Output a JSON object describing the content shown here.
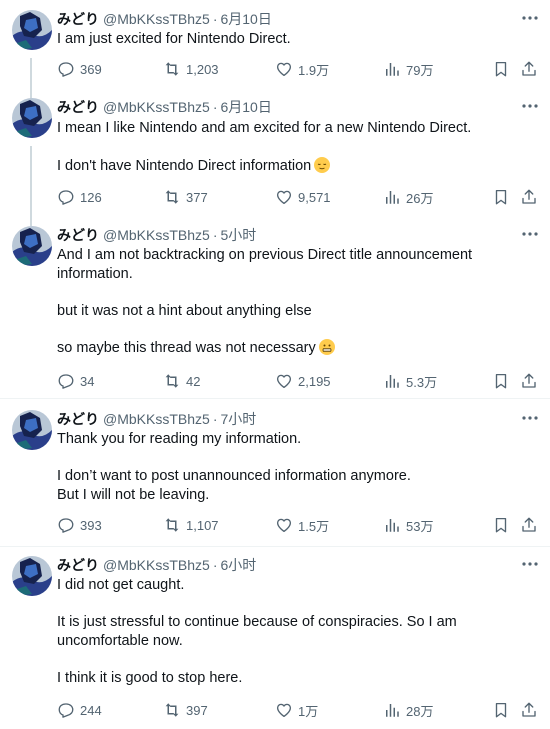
{
  "author": {
    "display_name": "みどり",
    "handle": "@MbKKssTBhz5"
  },
  "separator": "·",
  "tweets": [
    {
      "time": "6月10日",
      "paragraphs": [
        "I am just excited for Nintendo Direct."
      ],
      "emoji": null,
      "stats": {
        "replies": "369",
        "retweets": "1,203",
        "likes": "1.9万",
        "views": "79万"
      }
    },
    {
      "time": "6月10日",
      "paragraphs": [
        "I mean I like Nintendo and am excited for a new Nintendo Direct.",
        "I don't have Nintendo Direct information"
      ],
      "emoji": "relieved-face",
      "stats": {
        "replies": "126",
        "retweets": "377",
        "likes": "9,571",
        "views": "26万"
      }
    },
    {
      "time": "5小时",
      "paragraphs": [
        "And I am not backtracking on previous Direct title announcement information.",
        "but it was not a hint about anything else",
        "so maybe this thread was not necessary"
      ],
      "emoji": "grimacing-face",
      "stats": {
        "replies": "34",
        "retweets": "42",
        "likes": "2,195",
        "views": "5.3万"
      }
    },
    {
      "time": "7小时",
      "paragraphs": [
        "Thank you for reading my information.",
        "I don’t want to post unannounced information anymore.\nBut I will not be leaving."
      ],
      "emoji": null,
      "stats": {
        "replies": "393",
        "retweets": "1,107",
        "likes": "1.5万",
        "views": "53万"
      }
    },
    {
      "time": "6小时",
      "paragraphs": [
        "I did not get caught.",
        "It is just stressful to continue because of conspiracies. So I am uncomfortable now.",
        "I think it is good to stop here."
      ],
      "emoji": null,
      "stats": {
        "replies": "244",
        "retweets": "397",
        "likes": "1万",
        "views": "28万"
      }
    }
  ],
  "icons": [
    "reply-icon",
    "retweet-icon",
    "like-icon",
    "views-icon",
    "bookmark-icon",
    "share-icon",
    "more-icon"
  ],
  "colors": {
    "text": "#0f1419",
    "muted": "#536471",
    "thread_line": "#cfd9de",
    "divider": "#eff3f4",
    "emoji": "#ffcc4d"
  }
}
